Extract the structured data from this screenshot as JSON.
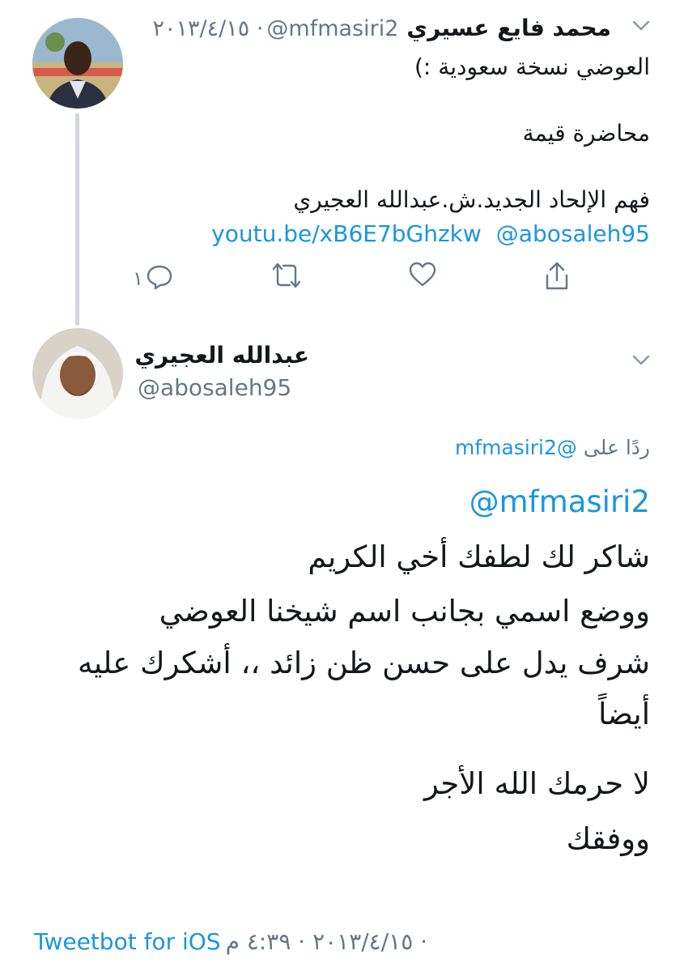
{
  "tweet1": {
    "name": "محمد فايع عسيري",
    "handle": "@mfmasiri2",
    "time": "· ٢٠١٣/٤/١٥",
    "lines": [
      "العوضي نسخة سعودية :)",
      "محاضرة قيمة",
      "فهم الإلحاد الجديد.ش.عبدالله العجيري"
    ],
    "link_url": "youtu.be/xB6E7bGhzkw",
    "link_mention": "@abosaleh95",
    "reply_count": "١",
    "icons": [
      "reply-icon",
      "retweet-icon",
      "like-icon",
      "share-icon",
      "chevron-down-icon"
    ]
  },
  "tweet2": {
    "name": "عبدالله العجيري",
    "handle": "@abosaleh95",
    "replying_prefix": "ردًا على",
    "replying_to": "@mfmasiri2",
    "mention": "@mfmasiri2",
    "lines": [
      "شاكر لك لطفك أخي الكريم",
      "ووضع اسمي بجانب اسم شيخنا العوضي",
      "شرف يدل على حسن ظن زائد ،، أشكرك عليه",
      "أيضاً",
      "لا حرمك الله الأجر",
      "ووفقك"
    ],
    "source": "Tweetbot for iOS",
    "meta": "· ٢٠١٣/٤/١٥ · ٤:٣٩ م"
  },
  "colors": {
    "link": "#1b95e0",
    "muted": "#657786",
    "text": "#14171a",
    "thread_line": "#cfd6dc"
  }
}
